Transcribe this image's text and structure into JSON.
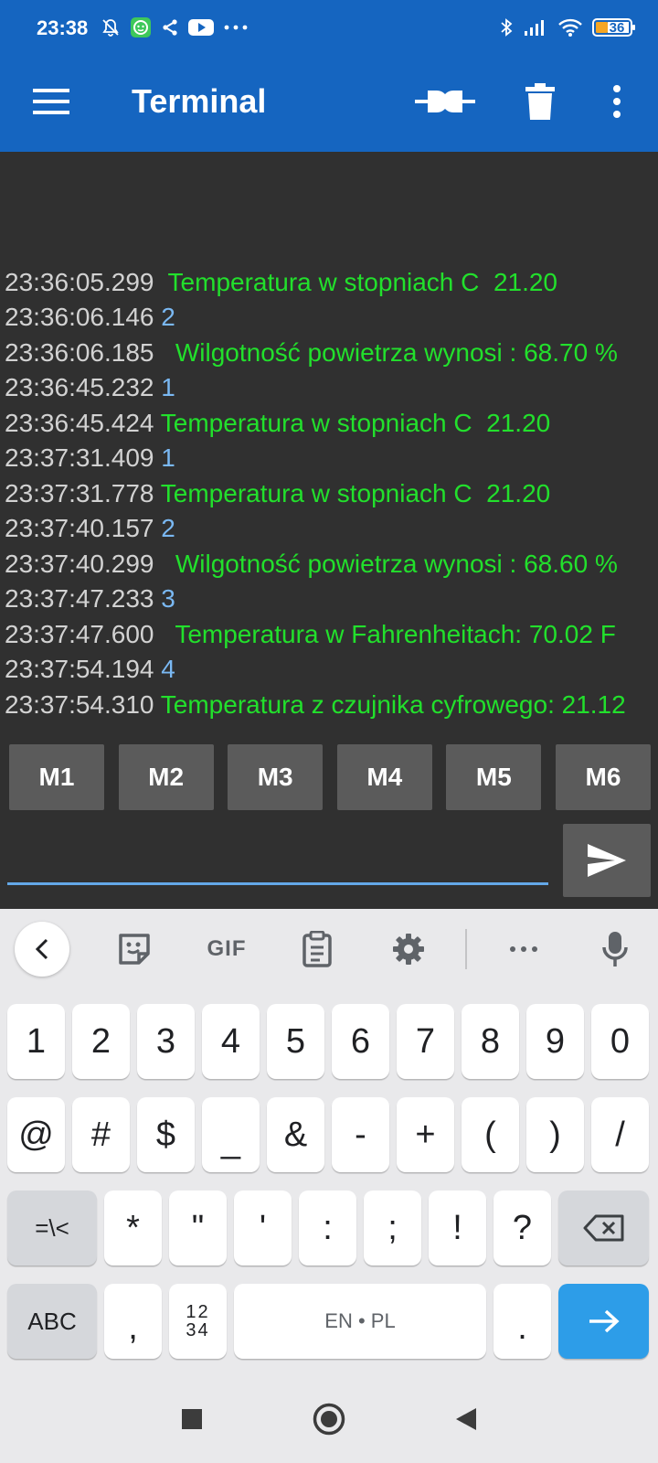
{
  "status_bar": {
    "time": "23:38",
    "battery_level": "36",
    "icons_left": [
      "mute-icon",
      "app-notification-icon",
      "share-icon",
      "youtube-icon",
      "more-notifications-icon"
    ],
    "icons_right": [
      "bluetooth-icon",
      "signal-icon",
      "wifi-icon",
      "battery-icon"
    ]
  },
  "app_bar": {
    "title": "Terminal",
    "icons": [
      "menu-icon",
      "connect-plug-icon",
      "delete-icon",
      "overflow-icon"
    ]
  },
  "terminal": {
    "colors": {
      "timestamp": "#d2d2d2",
      "sent": "#7ab8f2",
      "received": "#22e02c"
    },
    "lines": [
      {
        "ts": "23:36:05.299",
        "kind": "recv",
        "text": " Temperatura w stopniach C  21.20"
      },
      {
        "ts": "23:36:06.146",
        "kind": "sent",
        "text": "2"
      },
      {
        "ts": "23:36:06.185",
        "kind": "recv",
        "text": "  Wilgotność powietrza wynosi : 68.70 %"
      },
      {
        "ts": "23:36:45.232",
        "kind": "sent",
        "text": "1"
      },
      {
        "ts": "23:36:45.424",
        "kind": "recv",
        "text": "Temperatura w stopniach C  21.20"
      },
      {
        "ts": "23:37:31.409",
        "kind": "sent",
        "text": "1"
      },
      {
        "ts": "23:37:31.778",
        "kind": "recv",
        "text": "Temperatura w stopniach C  21.20"
      },
      {
        "ts": "23:37:40.157",
        "kind": "sent",
        "text": "2"
      },
      {
        "ts": "23:37:40.299",
        "kind": "recv",
        "text": "  Wilgotność powietrza wynosi : 68.60 %"
      },
      {
        "ts": "23:37:47.233",
        "kind": "sent",
        "text": "3"
      },
      {
        "ts": "23:37:47.600",
        "kind": "recv",
        "text": "  Temperatura w Fahrenheitach: 70.02 F"
      },
      {
        "ts": "23:37:54.194",
        "kind": "sent",
        "text": "4"
      },
      {
        "ts": "23:37:54.310",
        "kind": "recv",
        "text": "Temperatura z czujnika cyfrowego: 21.12"
      }
    ]
  },
  "macros": [
    "M1",
    "M2",
    "M3",
    "M4",
    "M5",
    "M6"
  ],
  "input": {
    "value": "",
    "placeholder": "",
    "send_icon": "send-icon"
  },
  "keyboard": {
    "toolbar_icons": [
      "back-chevron-icon",
      "sticker-icon",
      "gif-icon",
      "clipboard-icon",
      "settings-icon",
      "more-icon",
      "microphone-icon"
    ],
    "toolbar_gif_label": "GIF",
    "row1": [
      "1",
      "2",
      "3",
      "4",
      "5",
      "6",
      "7",
      "8",
      "9",
      "0"
    ],
    "row2": [
      "@",
      "#",
      "$",
      "_",
      "&",
      "-",
      "+",
      "(",
      ")",
      "/"
    ],
    "row3": {
      "shift_label": "=\\<",
      "keys": [
        "*",
        "\"",
        "'",
        ":",
        ";",
        "!",
        "?"
      ],
      "backspace_icon": "backspace-icon"
    },
    "row4": {
      "abc_label": "ABC",
      "comma": ",",
      "numpad_top": "12",
      "numpad_bottom": "34",
      "space_label": "EN • PL",
      "period": ".",
      "enter_icon": "arrow-right-icon"
    },
    "colors": {
      "key": "#ffffff",
      "function_key": "#d5d7db",
      "enter_key": "#2d9de8",
      "background": "#e9e9eb"
    }
  },
  "nav_bar": {
    "icons": [
      "recents-square-icon",
      "home-circle-icon",
      "back-triangle-icon"
    ]
  }
}
